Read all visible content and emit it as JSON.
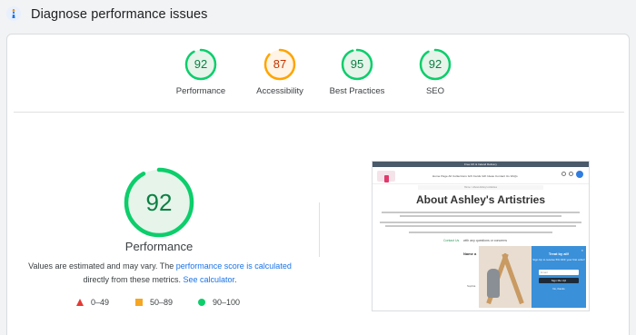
{
  "header": {
    "title": "Diagnose performance issues",
    "icon": "lighthouse-icon"
  },
  "scores": [
    {
      "label": "Performance",
      "value": 92,
      "color": "#0cce6b",
      "text_color": "#0b8043",
      "fill": "#e6f4ea"
    },
    {
      "label": "Accessibility",
      "value": 87,
      "color": "#ffa400",
      "text_color": "#c33300",
      "fill": "#fff4e5"
    },
    {
      "label": "Best Practices",
      "value": 95,
      "color": "#0cce6b",
      "text_color": "#0b8043",
      "fill": "#e6f4ea"
    },
    {
      "label": "SEO",
      "value": 92,
      "color": "#0cce6b",
      "text_color": "#0b8043",
      "fill": "#e6f4ea"
    }
  ],
  "main_score": {
    "value": 92,
    "title": "Performance",
    "desc_1": "Values are estimated and may vary. The ",
    "desc_link_1": "performance score is calculated",
    "desc_2": " directly from these metrics. ",
    "desc_link_2": "See calculator",
    "desc_3": "."
  },
  "legend": [
    {
      "label": "0–49",
      "shape": "triangle",
      "color": "#e53935"
    },
    {
      "label": "50–89",
      "shape": "square",
      "color": "#f5a623"
    },
    {
      "label": "90–100",
      "shape": "circle",
      "color": "#0cce6b"
    }
  ],
  "screenshot": {
    "topbar": "Free UK & Ireland Delivery",
    "menu": "Home Page   All Collections   Gift Cards   Gift Ideas   Contact Us   FAQs",
    "breadcrumb": "Home  >  About Ashley's Artistries",
    "heading": "About Ashley's Artistries",
    "contact_green": "Contact Us",
    "contact_rest": "with any questions or concerns",
    "subhead": "Name a",
    "popup_title": "Treat by all!",
    "popup_text": "Sign Up to receive 5% OFF your first order!",
    "popup_input": "Email",
    "popup_button": "Sign Me Up!",
    "popup_no": "No, thanks",
    "popup_close": "×",
    "side_text": "Sophia"
  }
}
